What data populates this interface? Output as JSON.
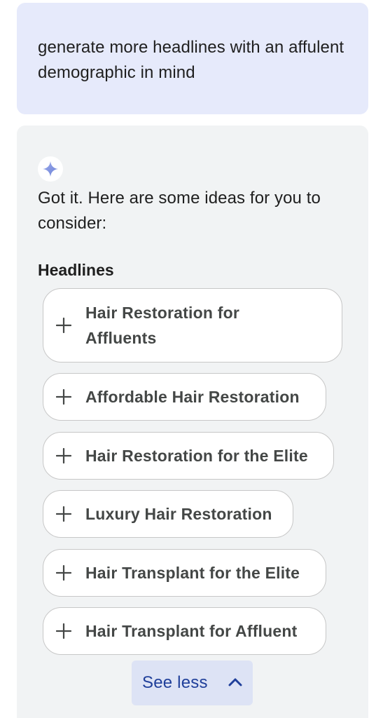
{
  "user_prompt": {
    "text": "generate more headlines with an affulent demographic in mind"
  },
  "response": {
    "icon": "sparkle-icon",
    "intro": "Got it. Here are some ideas for you to consider:",
    "section_title": "Headlines",
    "headlines": [
      {
        "label": "Hair Restoration for Affluents",
        "icon": "plus-icon"
      },
      {
        "label": "Affordable Hair Restoration",
        "icon": "plus-icon"
      },
      {
        "label": "Hair Restoration for the Elite",
        "icon": "plus-icon"
      },
      {
        "label": "Luxury Hair Restoration",
        "icon": "plus-icon"
      },
      {
        "label": "Hair Transplant for the Elite",
        "icon": "plus-icon"
      },
      {
        "label": "Hair Transplant for Affluent",
        "icon": "plus-icon"
      }
    ],
    "toggle_label": "See less",
    "toggle_icon": "chevron-up-icon"
  },
  "colors": {
    "user_bubble_bg": "#e6eafb",
    "card_bg": "#f1f3f4",
    "chip_border": "#c7c7c7",
    "chip_text": "#444746",
    "button_bg": "#dde3f5",
    "button_text": "#1f3f9a",
    "sparkle": "#7b8fe0"
  }
}
